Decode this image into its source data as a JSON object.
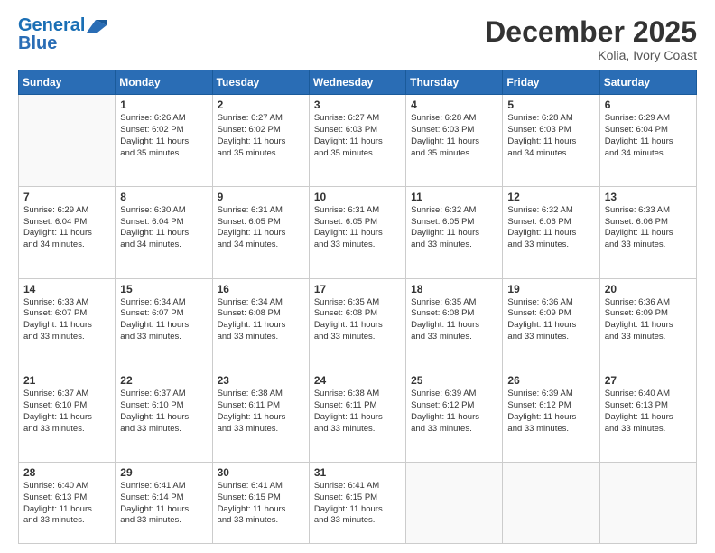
{
  "logo": {
    "line1": "General",
    "line2": "Blue",
    "icon_color": "#2a6db5"
  },
  "header": {
    "month": "December 2025",
    "location": "Kolia, Ivory Coast"
  },
  "days_of_week": [
    "Sunday",
    "Monday",
    "Tuesday",
    "Wednesday",
    "Thursday",
    "Friday",
    "Saturday"
  ],
  "weeks": [
    [
      {
        "day": "",
        "empty": true
      },
      {
        "day": "1",
        "sunrise": "6:26 AM",
        "sunset": "6:02 PM",
        "daylight": "11 hours and 35 minutes."
      },
      {
        "day": "2",
        "sunrise": "6:27 AM",
        "sunset": "6:02 PM",
        "daylight": "11 hours and 35 minutes."
      },
      {
        "day": "3",
        "sunrise": "6:27 AM",
        "sunset": "6:03 PM",
        "daylight": "11 hours and 35 minutes."
      },
      {
        "day": "4",
        "sunrise": "6:28 AM",
        "sunset": "6:03 PM",
        "daylight": "11 hours and 35 minutes."
      },
      {
        "day": "5",
        "sunrise": "6:28 AM",
        "sunset": "6:03 PM",
        "daylight": "11 hours and 34 minutes."
      },
      {
        "day": "6",
        "sunrise": "6:29 AM",
        "sunset": "6:04 PM",
        "daylight": "11 hours and 34 minutes."
      }
    ],
    [
      {
        "day": "7",
        "sunrise": "6:29 AM",
        "sunset": "6:04 PM",
        "daylight": "11 hours and 34 minutes."
      },
      {
        "day": "8",
        "sunrise": "6:30 AM",
        "sunset": "6:04 PM",
        "daylight": "11 hours and 34 minutes."
      },
      {
        "day": "9",
        "sunrise": "6:31 AM",
        "sunset": "6:05 PM",
        "daylight": "11 hours and 34 minutes."
      },
      {
        "day": "10",
        "sunrise": "6:31 AM",
        "sunset": "6:05 PM",
        "daylight": "11 hours and 33 minutes."
      },
      {
        "day": "11",
        "sunrise": "6:32 AM",
        "sunset": "6:05 PM",
        "daylight": "11 hours and 33 minutes."
      },
      {
        "day": "12",
        "sunrise": "6:32 AM",
        "sunset": "6:06 PM",
        "daylight": "11 hours and 33 minutes."
      },
      {
        "day": "13",
        "sunrise": "6:33 AM",
        "sunset": "6:06 PM",
        "daylight": "11 hours and 33 minutes."
      }
    ],
    [
      {
        "day": "14",
        "sunrise": "6:33 AM",
        "sunset": "6:07 PM",
        "daylight": "11 hours and 33 minutes."
      },
      {
        "day": "15",
        "sunrise": "6:34 AM",
        "sunset": "6:07 PM",
        "daylight": "11 hours and 33 minutes."
      },
      {
        "day": "16",
        "sunrise": "6:34 AM",
        "sunset": "6:08 PM",
        "daylight": "11 hours and 33 minutes."
      },
      {
        "day": "17",
        "sunrise": "6:35 AM",
        "sunset": "6:08 PM",
        "daylight": "11 hours and 33 minutes."
      },
      {
        "day": "18",
        "sunrise": "6:35 AM",
        "sunset": "6:08 PM",
        "daylight": "11 hours and 33 minutes."
      },
      {
        "day": "19",
        "sunrise": "6:36 AM",
        "sunset": "6:09 PM",
        "daylight": "11 hours and 33 minutes."
      },
      {
        "day": "20",
        "sunrise": "6:36 AM",
        "sunset": "6:09 PM",
        "daylight": "11 hours and 33 minutes."
      }
    ],
    [
      {
        "day": "21",
        "sunrise": "6:37 AM",
        "sunset": "6:10 PM",
        "daylight": "11 hours and 33 minutes."
      },
      {
        "day": "22",
        "sunrise": "6:37 AM",
        "sunset": "6:10 PM",
        "daylight": "11 hours and 33 minutes."
      },
      {
        "day": "23",
        "sunrise": "6:38 AM",
        "sunset": "6:11 PM",
        "daylight": "11 hours and 33 minutes."
      },
      {
        "day": "24",
        "sunrise": "6:38 AM",
        "sunset": "6:11 PM",
        "daylight": "11 hours and 33 minutes."
      },
      {
        "day": "25",
        "sunrise": "6:39 AM",
        "sunset": "6:12 PM",
        "daylight": "11 hours and 33 minutes."
      },
      {
        "day": "26",
        "sunrise": "6:39 AM",
        "sunset": "6:12 PM",
        "daylight": "11 hours and 33 minutes."
      },
      {
        "day": "27",
        "sunrise": "6:40 AM",
        "sunset": "6:13 PM",
        "daylight": "11 hours and 33 minutes."
      }
    ],
    [
      {
        "day": "28",
        "sunrise": "6:40 AM",
        "sunset": "6:13 PM",
        "daylight": "11 hours and 33 minutes."
      },
      {
        "day": "29",
        "sunrise": "6:41 AM",
        "sunset": "6:14 PM",
        "daylight": "11 hours and 33 minutes."
      },
      {
        "day": "30",
        "sunrise": "6:41 AM",
        "sunset": "6:15 PM",
        "daylight": "11 hours and 33 minutes."
      },
      {
        "day": "31",
        "sunrise": "6:41 AM",
        "sunset": "6:15 PM",
        "daylight": "11 hours and 33 minutes."
      },
      {
        "day": "",
        "empty": true
      },
      {
        "day": "",
        "empty": true
      },
      {
        "day": "",
        "empty": true
      }
    ]
  ]
}
